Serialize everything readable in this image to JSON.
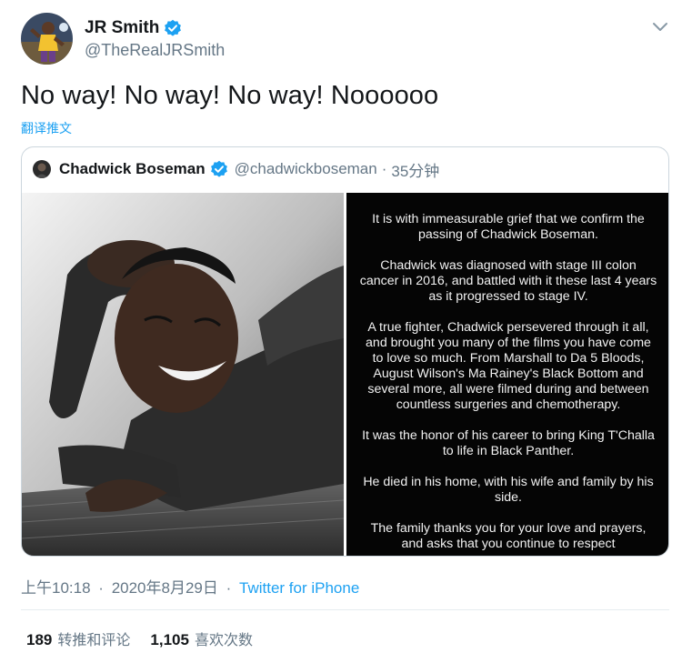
{
  "author": {
    "display_name": "JR Smith",
    "handle": "@TheRealJRSmith",
    "verified": true,
    "avatar_icon": "player-avatar"
  },
  "tweet": {
    "text": "No way! No way! No way! Noooooo",
    "translate_label": "翻译推文"
  },
  "quoted_tweet": {
    "display_name": "Chadwick Boseman",
    "handle": "@chadwickboseman",
    "separator": "·",
    "time_ago": "35分钟",
    "verified": true,
    "statement": "It is with immeasurable grief that we confirm the passing of Chadwick Boseman.\n\nChadwick was diagnosed with stage III colon cancer in 2016, and battled with it these last 4 years as it progressed to stage IV.\n\nA true fighter, Chadwick persevered through it all, and brought you many of the films you have come to love so much. From Marshall to Da 5 Bloods, August Wilson's Ma Rainey's Black Bottom and several more, all were filmed during and between countless surgeries and chemotherapy.\n\nIt was the honor of his career to bring King T'Challa to life in Black Panther.\n\nHe died in his home, with his wife and family by his side.\n\nThe family thanks you for your love and prayers, and asks that you continue to respect"
  },
  "meta": {
    "time": "上午10:18",
    "separator1": "·",
    "date": "2020年8月29日",
    "separator2": "·",
    "source": "Twitter for iPhone"
  },
  "stats": {
    "retweets_count": "189",
    "retweets_label": "转推和评论",
    "likes_count": "1,105",
    "likes_label": "喜欢次数"
  },
  "colors": {
    "accent": "#1da1f2",
    "secondary_text": "#657786",
    "primary_text": "#14171a",
    "border": "#ccd6dd"
  }
}
